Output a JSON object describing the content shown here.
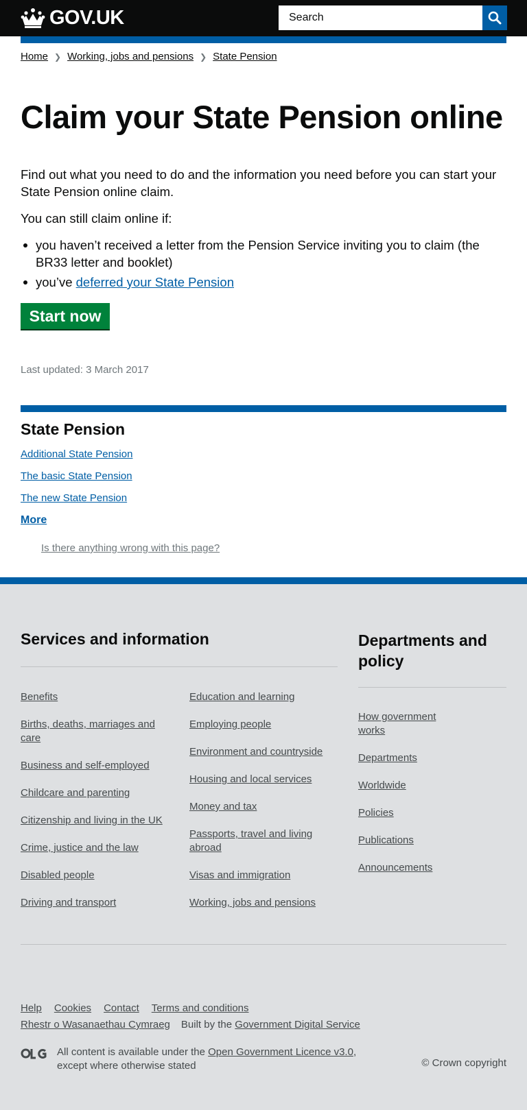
{
  "header": {
    "logo_text": "GOV.UK",
    "search_placeholder": "Search"
  },
  "breadcrumbs": [
    {
      "label": "Home"
    },
    {
      "label": "Working, jobs and pensions"
    },
    {
      "label": "State Pension"
    }
  ],
  "main": {
    "title": "Claim your State Pension online",
    "lead": "Find out what you need to do and the information you need before you can start your State Pension online claim.",
    "intro": "You can still claim online if:",
    "bullet1": "you haven’t received a letter from the Pension Service inviting you to claim (the BR33 letter and booklet)",
    "bullet2_prefix": "you’ve ",
    "bullet2_link": "deferred your State Pension",
    "start_button": "Start now",
    "last_updated": "Last updated: 3 March 2017"
  },
  "related": {
    "title": "State Pension",
    "links": [
      "Additional State Pension",
      "The basic State Pension",
      "The new State Pension"
    ],
    "more": "More",
    "report": "Is there anything wrong with this page?"
  },
  "footer": {
    "services_heading": "Services and information",
    "services_col1": [
      "Benefits",
      "Births, deaths, marriages and care",
      "Business and self-employed",
      "Childcare and parenting",
      "Citizenship and living in the UK",
      "Crime, justice and the law",
      "Disabled people",
      "Driving and transport"
    ],
    "services_col2": [
      "Education and learning",
      "Employing people",
      "Environment and countryside",
      "Housing and local services",
      "Money and tax",
      "Passports, travel and living abroad",
      "Visas and immigration",
      "Working, jobs and pensions"
    ],
    "departments_heading": "Departments and policy",
    "departments": [
      "How government works",
      "Departments",
      "Worldwide",
      "Policies",
      "Publications",
      "Announcements"
    ],
    "meta_links": [
      "Help",
      "Cookies",
      "Contact",
      "Terms and conditions"
    ],
    "welsh_link": "Rhestr o Wasanaethau Cymraeg",
    "built_by_prefix": "Built by the ",
    "built_by_link": "Government Digital Service",
    "licence_prefix": "All content is available under the ",
    "licence_link": "Open Government Licence v3.0",
    "licence_suffix": ", except where otherwise stated",
    "copyright": "© Crown copyright"
  },
  "colors": {
    "header_bg": "#0b0c0c",
    "brand_blue": "#005ea5",
    "start_green": "#00823b",
    "footer_bg": "#dee0e2"
  },
  "icons": [
    "crown-icon",
    "search-icon",
    "chevron-right-icon",
    "ogl-licence-icon"
  ]
}
